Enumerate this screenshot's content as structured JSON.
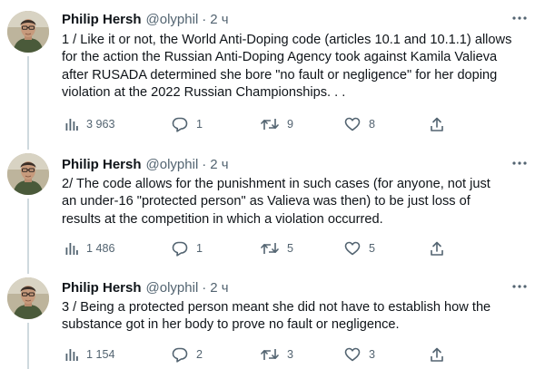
{
  "tweets": [
    {
      "author_name": "Philip Hersh",
      "handle": "@olyphil",
      "separator": "·",
      "time": "2 ч",
      "text": "1 / Like it or not, the World Anti-Doping code (articles 10.1 and 10.1.1) allows\nfor the action the Russian Anti-Doping Agency took against Kamila Valieva\nafter RUSADA determined she bore \"no fault or negligence\" for her doping\nviolation at the 2022 Russian Championships. . .",
      "views": "3 963",
      "replies": "1",
      "retweets": "9",
      "likes": "8"
    },
    {
      "author_name": "Philip Hersh",
      "handle": "@olyphil",
      "separator": "·",
      "time": "2 ч",
      "text": "2/ The code allows for the punishment in such cases (for anyone, not just\nan under-16 \"protected person\" as Valieva was then) to be just loss of\nresults at the competition in which a violation occurred.",
      "views": "1 486",
      "replies": "1",
      "retweets": "5",
      "likes": "5"
    },
    {
      "author_name": "Philip Hersh",
      "handle": "@olyphil",
      "separator": "·",
      "time": "2 ч",
      "text": "3 / Being a protected person meant she did not have to establish how the\nsubstance got in her body to prove no fault or negligence.",
      "views": "1 154",
      "replies": "2",
      "retweets": "3",
      "likes": "3"
    }
  ],
  "icons": {
    "views": "bar-chart-icon",
    "reply": "speech-bubble-icon",
    "retweet": "retweet-arrows-icon",
    "like": "heart-icon",
    "share": "share-upload-icon",
    "more": "more-dots-icon"
  },
  "colors": {
    "text": "#0f1419",
    "secondary": "#536471",
    "thread_line": "#cfd9de",
    "divider": "#eff3f4"
  }
}
